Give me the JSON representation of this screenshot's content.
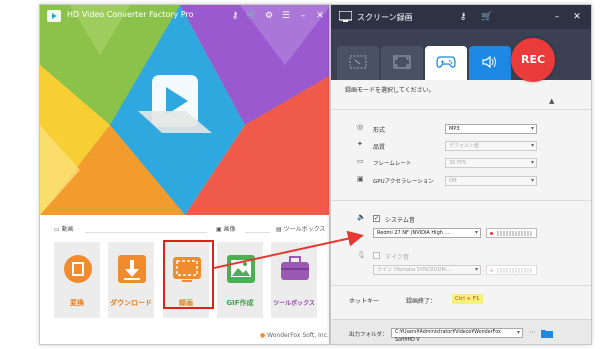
{
  "main_window": {
    "title": "HD Video Converter Factory Pro",
    "sections": {
      "video": "動画",
      "image": "画像",
      "tools": "ツールボックス"
    },
    "tiles": [
      {
        "label": "変換",
        "icon": "film-reel-icon",
        "color": "#f08c2e"
      },
      {
        "label": "ダウンロード",
        "icon": "download-icon",
        "color": "#f08c2e"
      },
      {
        "label": "録画",
        "icon": "screen-record-icon",
        "color": "#f08c2e"
      },
      {
        "label": "GIF作成",
        "icon": "image-landscape-icon",
        "color": "#4caf50"
      },
      {
        "label": "ツールボックス",
        "icon": "toolbox-icon",
        "color": "#9b59b6"
      }
    ],
    "brand": "WonderFox Soft, Inc."
  },
  "recorder_window": {
    "title": "スクリーン録画",
    "rec_label": "REC",
    "mode_prompt": "録画モードを選択してください。",
    "settings": [
      {
        "label": "形式",
        "value": "MP3",
        "enabled": true
      },
      {
        "label": "品質",
        "value": "デフォルト値",
        "enabled": false
      },
      {
        "label": "フレームレート",
        "value": "30 FPS",
        "enabled": false
      },
      {
        "label": "GPUアクセラレーション",
        "value": "Off",
        "enabled": false
      }
    ],
    "system_audio": {
      "label": "システム音",
      "checked": true,
      "device": "Redmi 27 NF (NVIDIA High ..."
    },
    "mic_audio": {
      "label": "マイク音",
      "checked": false,
      "device": "ライン (Yamaha SYNCROOM..."
    },
    "hotkey": {
      "label": "ホットキー",
      "action": "録画終了：",
      "keys": "Ctrl + F1"
    },
    "output": {
      "label": "出力フォルダ：",
      "path": "C:¥Users¥Administrator¥Videos¥WonderFox Soft¥HD V"
    }
  },
  "colors": {
    "accent_red": "#d9241c",
    "rec_red": "#ea3a3a",
    "dark_header": "#2e3344",
    "active_tab": "#1e88e5"
  }
}
